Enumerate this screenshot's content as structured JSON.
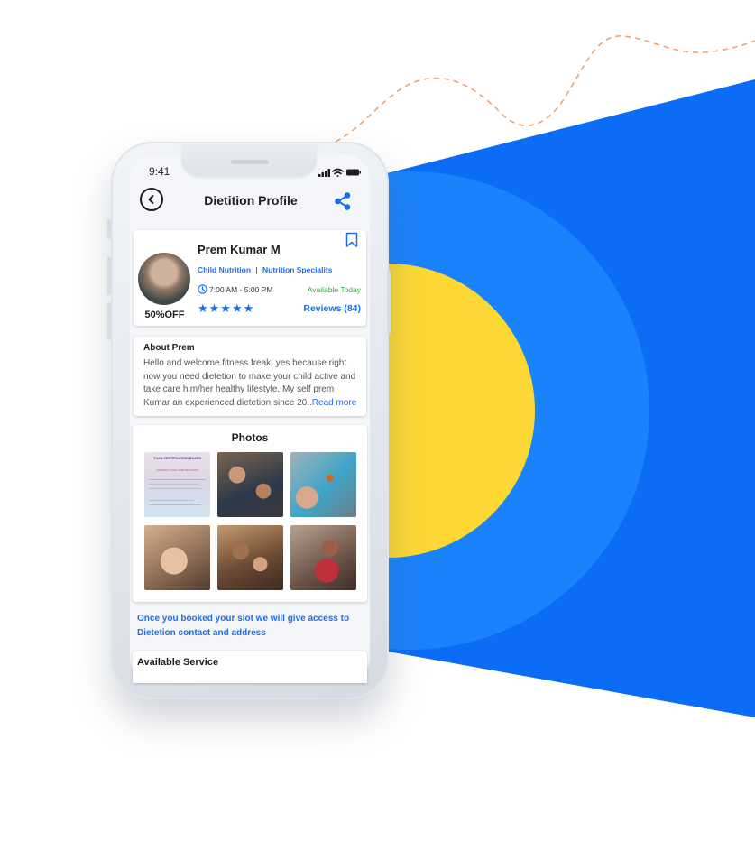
{
  "status_bar": {
    "time": "9:41"
  },
  "header": {
    "title": "Dietition Profile"
  },
  "profile": {
    "name": "Prem Kumar M",
    "specialties": [
      "Child Nutrition",
      "Nutrition Specialits"
    ],
    "separator": "|",
    "hours": "7:00 AM - 5:00 PM",
    "availability": "Available Today",
    "discount": "50%OFF",
    "rating_stars": "★★★★★",
    "rating": 5,
    "reviews": "Reviews (84)"
  },
  "about": {
    "title": "About Prem",
    "text": "Hello and welcome fitness freak, yes because right now you need dietetion to make your child active and take care him/her healthy lifestyle. My self prem Kumar an experienced dietetion since 20..",
    "read_more": "Read more"
  },
  "photos": {
    "title": "Photos",
    "certificate": {
      "heading": "YOGA CERTIFICATION BOARD",
      "subheading": "LEADING YOGA CERTIFICATION"
    }
  },
  "access_note": "Once you booked your slot we will give access to Dietetion contact and address",
  "services": {
    "title": "Available Service"
  },
  "icons": [
    "back-icon",
    "share-icon",
    "bookmark-icon",
    "clock-icon",
    "signal-icon",
    "wifi-icon",
    "battery-icon"
  ],
  "colors": {
    "accent": "#1a6fe8",
    "available": "#2eab3e",
    "background_blue": "#0b6cf5",
    "background_circle": "#1a82fb",
    "sun_yellow": "#fcd834",
    "dashed_line": "#e9a06a"
  }
}
